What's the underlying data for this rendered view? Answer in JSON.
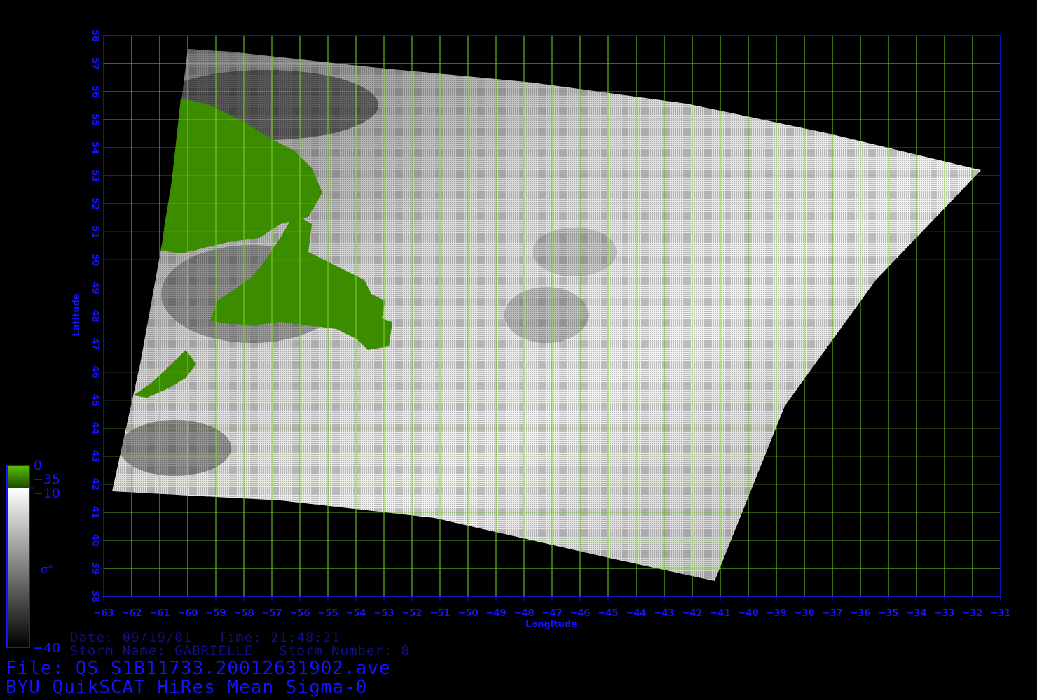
{
  "map": {
    "lon_ticks": [
      "-63",
      "-62",
      "-61",
      "-60",
      "-59",
      "-58",
      "-57",
      "-56",
      "-55",
      "-54",
      "-53",
      "-52",
      "-51",
      "-50",
      "-49",
      "-48",
      "-47",
      "-46",
      "-45",
      "-44",
      "-43",
      "-42",
      "-41",
      "-40",
      "-39",
      "-38",
      "-37",
      "-36",
      "-35",
      "-34",
      "-33",
      "-32",
      "-31"
    ],
    "lat_ticks": [
      "38",
      "39",
      "40",
      "41",
      "42",
      "43",
      "44",
      "45",
      "46",
      "47",
      "48",
      "49",
      "50",
      "51",
      "52",
      "53",
      "54",
      "55",
      "56",
      "57",
      "58"
    ],
    "lon_range": [
      -63,
      -31
    ],
    "lat_range": [
      38,
      58
    ],
    "xlabel": "Longitude",
    "ylabel": "Latitude",
    "grid": true,
    "colors": {
      "grid": "#7fd62a",
      "axis": "#1414ff",
      "land": "#3c8c00",
      "background": "#000000"
    }
  },
  "colorbar": {
    "label_0": "0",
    "label_m35": "−35",
    "label_m10": "−10",
    "label_m40": "−40",
    "symbol": "σ°"
  },
  "info": {
    "date_line": "Date: 09/19/01   Time: 21:48:21",
    "storm_line": "Storm Name: GABRIELLE   Storm Number: 8"
  },
  "footer": {
    "file_line": "File: QS_S1B11733.20012631902.ave",
    "title_line": "BYU QuikSCAT HiRes Mean Sigma-0"
  }
}
